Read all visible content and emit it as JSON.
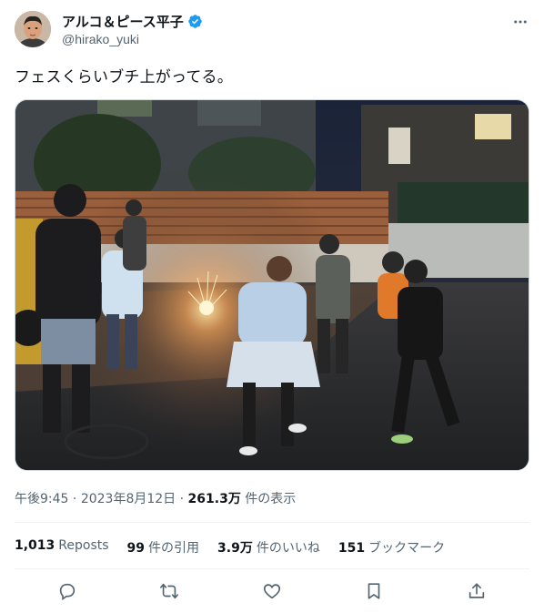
{
  "author": {
    "name": "アルコ＆ピース平子",
    "handle": "@hirako_yuki",
    "verified": true
  },
  "tweet": {
    "text": "フェスくらいブチ上がってる。"
  },
  "meta": {
    "time": "午後9:45",
    "date": "2023年8月12日",
    "views_value": "261.3万",
    "views_label": "件の表示",
    "separator": "·"
  },
  "stats": {
    "reposts_value": "1,013",
    "reposts_label": "Reposts",
    "quotes_value": "99",
    "quotes_label": "件の引用",
    "likes_value": "3.9万",
    "likes_label": "件のいいね",
    "bookmarks_value": "151",
    "bookmarks_label": "ブックマーク"
  },
  "icons": {
    "more": "more-icon",
    "reply": "reply-icon",
    "retweet": "retweet-icon",
    "like": "heart-icon",
    "bookmark": "bookmark-icon",
    "share": "share-icon"
  },
  "colors": {
    "verified": "#1d9bf0",
    "secondary_text": "#536471",
    "primary_text": "#0f1419"
  }
}
